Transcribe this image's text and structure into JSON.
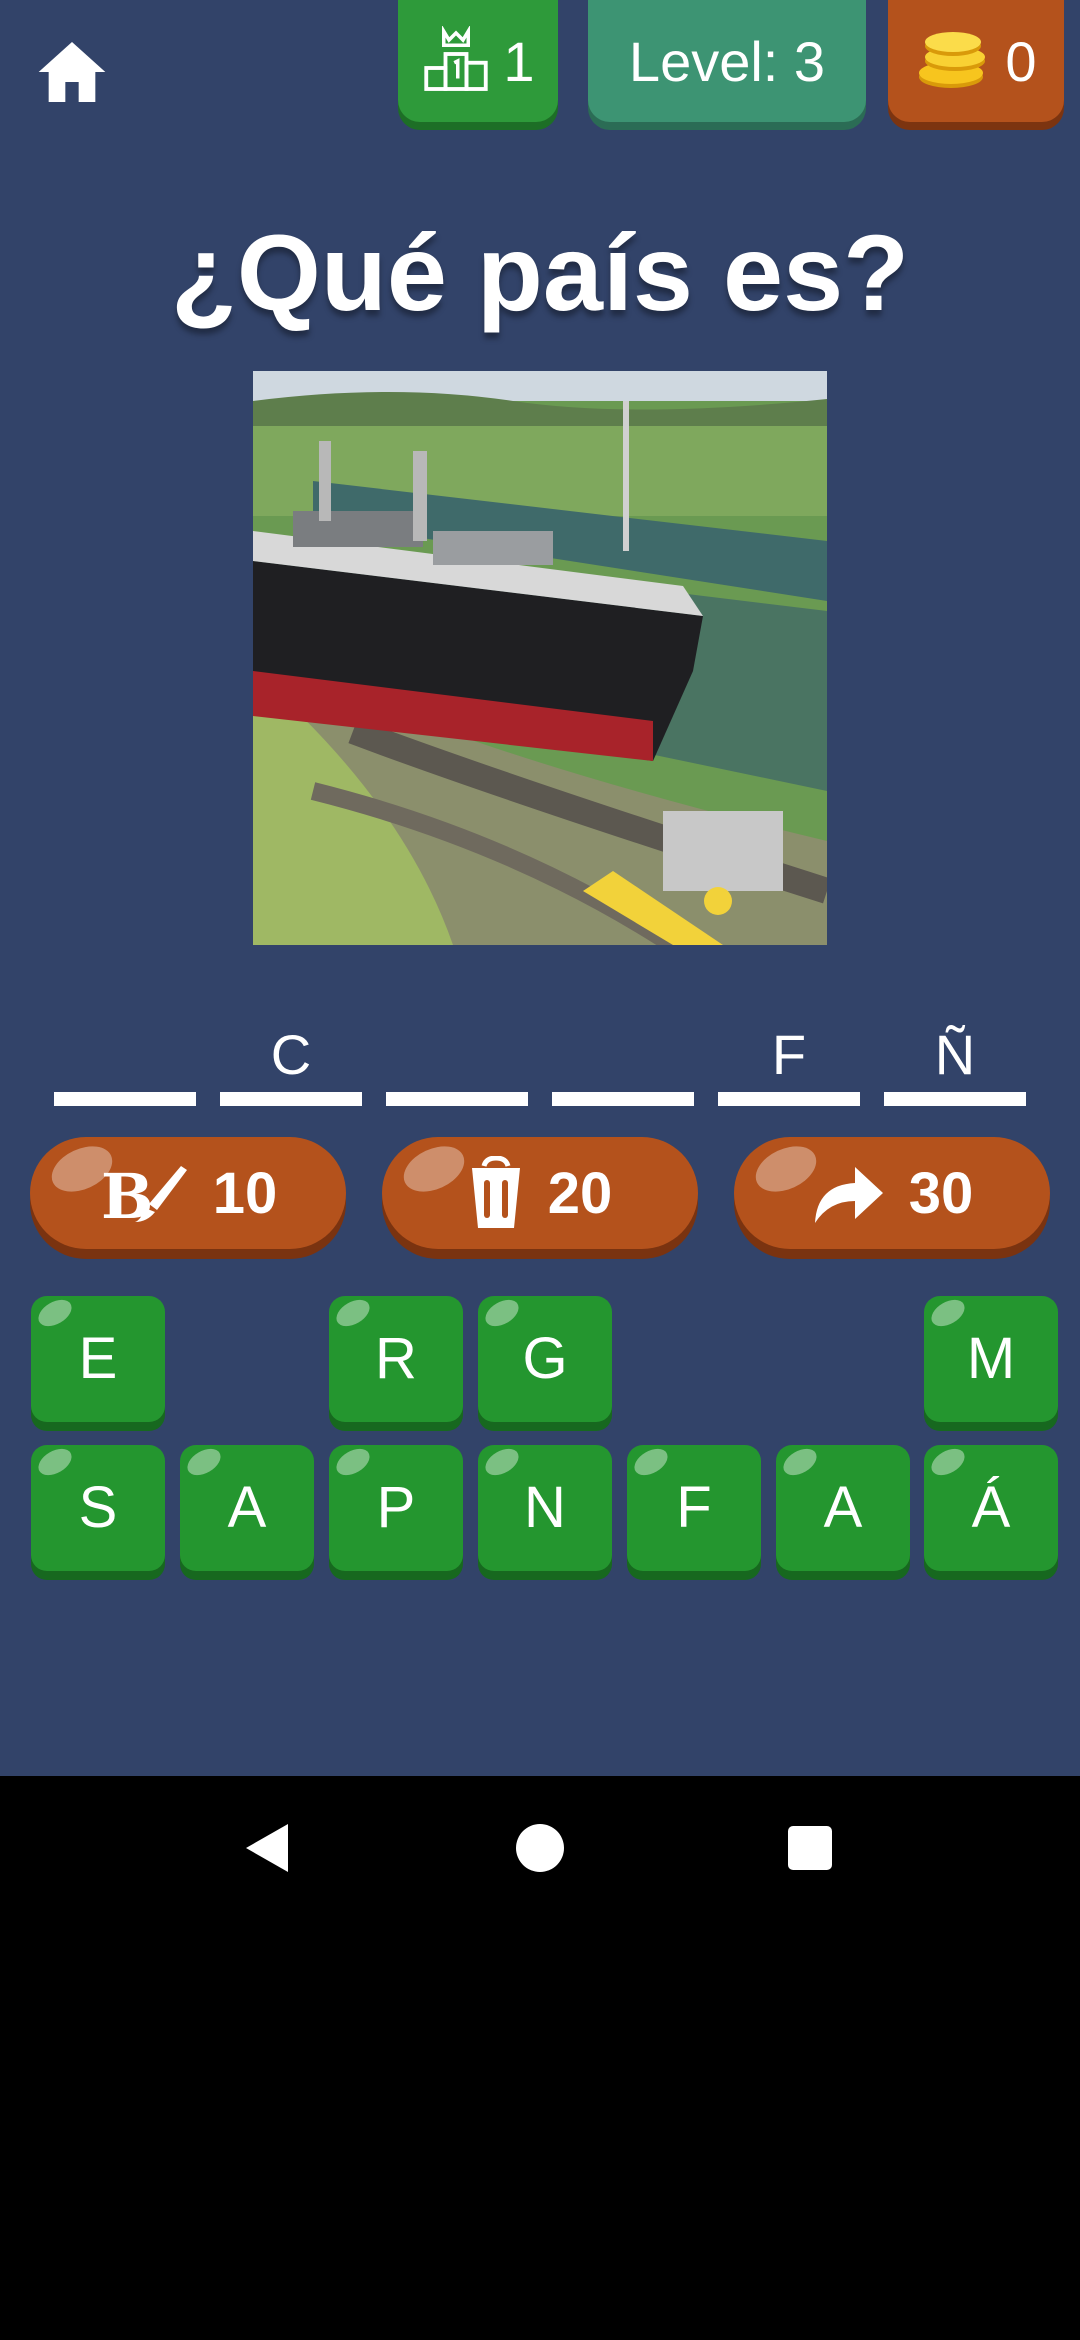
{
  "header": {
    "rank_value": "1",
    "level_label": "Level: 3",
    "coins_value": "0"
  },
  "question": {
    "title": "¿Qué país es?"
  },
  "answer_slots": [
    "",
    "C",
    "",
    "",
    "F",
    "Ñ"
  ],
  "powerups": [
    {
      "icon": "paint-brush-icon",
      "cost": "10"
    },
    {
      "icon": "trash-bin-icon",
      "cost": "20"
    },
    {
      "icon": "skip-arrow-icon",
      "cost": "30"
    }
  ],
  "keyboard": {
    "row1": [
      "E",
      "",
      "R",
      "G",
      "",
      "",
      "M"
    ],
    "row2": [
      "S",
      "A",
      "P",
      "N",
      "F",
      "A",
      "Á"
    ]
  },
  "navigation": {
    "back": "back-triangle-icon",
    "home": "home-circle-icon",
    "recents": "recents-square-icon"
  },
  "colors": {
    "background": "#324369",
    "key_green": "#24962f",
    "powerup_orange": "#b4521c",
    "level_teal": "#3d9473"
  }
}
